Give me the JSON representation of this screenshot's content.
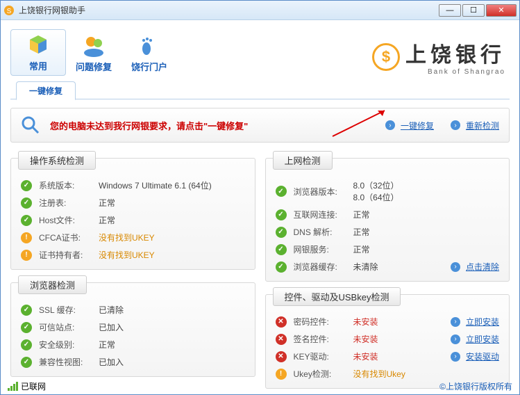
{
  "window": {
    "title": "上饶银行网银助手"
  },
  "toolbar": {
    "items": [
      {
        "label": "常用"
      },
      {
        "label": "问题修复"
      },
      {
        "label": "饶行门户"
      }
    ]
  },
  "bank": {
    "name_cn": "上饶银行",
    "name_en": "Bank of Shangrao"
  },
  "tab": {
    "label": "一键修复"
  },
  "alert": {
    "text": "您的电脑未达到我行网银要求，请点击\"一键修复\"",
    "repair": "一键修复",
    "recheck": "重新检测"
  },
  "panels": {
    "os": {
      "title": "操作系统检测",
      "rows": [
        {
          "status": "ok",
          "label": "系统版本:",
          "value": "Windows 7 Ultimate 6.1 (64位)"
        },
        {
          "status": "ok",
          "label": "注册表:",
          "value": "正常"
        },
        {
          "status": "ok",
          "label": "Host文件:",
          "value": "正常"
        },
        {
          "status": "warn",
          "label": "CFCA证书:",
          "value": "没有找到UKEY"
        },
        {
          "status": "warn",
          "label": "证书持有者:",
          "value": "没有找到UKEY"
        }
      ]
    },
    "net": {
      "title": "上网检测",
      "rows": [
        {
          "status": "ok",
          "label": "浏览器版本:",
          "value": "8.0（32位）\n8.0（64位）"
        },
        {
          "status": "ok",
          "label": "互联网连接:",
          "value": "正常"
        },
        {
          "status": "ok",
          "label": "DNS 解析:",
          "value": "正常"
        },
        {
          "status": "ok",
          "label": "网银服务:",
          "value": "正常"
        },
        {
          "status": "ok",
          "label": "浏览器缓存:",
          "value": "未清除",
          "action": "点击清除"
        }
      ]
    },
    "browser": {
      "title": "浏览器检测",
      "rows": [
        {
          "status": "ok",
          "label": "SSL 缓存:",
          "value": "已清除"
        },
        {
          "status": "ok",
          "label": "可信站点:",
          "value": "已加入"
        },
        {
          "status": "ok",
          "label": "安全级别:",
          "value": "正常"
        },
        {
          "status": "ok",
          "label": "兼容性视图:",
          "value": "已加入"
        }
      ]
    },
    "usb": {
      "title": "控件、驱动及USBkey检测",
      "rows": [
        {
          "status": "err",
          "label": "密码控件:",
          "value": "未安装",
          "action": "立即安装"
        },
        {
          "status": "err",
          "label": "签名控件:",
          "value": "未安装",
          "action": "立即安装"
        },
        {
          "status": "err",
          "label": "KEY驱动:",
          "value": "未安装",
          "action": "安装驱动"
        },
        {
          "status": "warn",
          "label": "Ukey检测:",
          "value": "没有找到Ukey"
        }
      ]
    }
  },
  "statusbar": {
    "net": "已联网",
    "copyright": "©上饶银行版权所有"
  }
}
